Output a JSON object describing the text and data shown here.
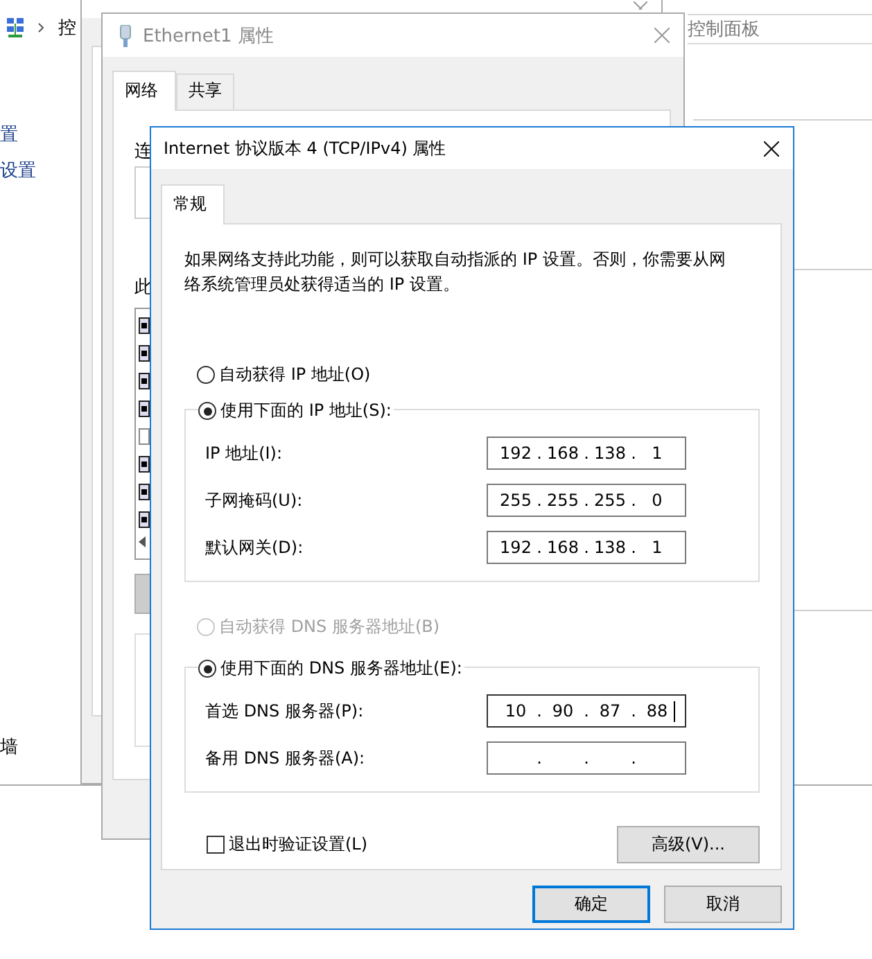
{
  "control_panel": {
    "breadcrumb": "控",
    "address_tail": "控制面板",
    "sidebar_items": [
      "置",
      "设置"
    ],
    "sidebar_bottom": "墙"
  },
  "properties_window": {
    "title": "Ethernet1 属性",
    "tabs": [
      {
        "label": "网络",
        "selected": true
      },
      {
        "label": "共享",
        "selected": false
      }
    ],
    "connect_label": "连",
    "list_label": "此",
    "components": [
      {
        "checked": true
      },
      {
        "checked": true
      },
      {
        "checked": true
      },
      {
        "checked": true
      },
      {
        "checked": false
      },
      {
        "checked": true
      },
      {
        "checked": true
      },
      {
        "checked": true
      }
    ]
  },
  "ipv4_dialog": {
    "title": "Internet 协议版本 4 (TCP/IPv4) 属性",
    "tabs": [
      {
        "label": "常规",
        "selected": true
      }
    ],
    "description": "如果网络支持此功能，则可以获取自动指派的 IP 设置。否则，你需要从网络系统管理员处获得适当的 IP 设置。",
    "separator": ".",
    "ip_options": [
      {
        "label": "自动获得 IP 地址(O)",
        "selected": false,
        "disabled": false
      },
      {
        "label": "使用下面的 IP 地址(S):",
        "selected": true,
        "disabled": false
      }
    ],
    "ip_fields": [
      {
        "label": "IP 地址(I):",
        "octets": [
          "192",
          "168",
          "138",
          "1"
        ]
      },
      {
        "label": "子网掩码(U):",
        "octets": [
          "255",
          "255",
          "255",
          "0"
        ]
      },
      {
        "label": "默认网关(D):",
        "octets": [
          "192",
          "168",
          "138",
          "1"
        ]
      }
    ],
    "dns_options": [
      {
        "label": "自动获得 DNS 服务器地址(B)",
        "selected": false,
        "disabled": true
      },
      {
        "label": "使用下面的 DNS 服务器地址(E):",
        "selected": true,
        "disabled": false
      }
    ],
    "dns_fields": [
      {
        "label": "首选 DNS 服务器(P):",
        "octets": [
          "10",
          "90",
          "87",
          "88"
        ],
        "focused": true
      },
      {
        "label": "备用 DNS 服务器(A):",
        "focused": false
      }
    ],
    "validate_checkbox": {
      "label": "退出时验证设置(L)",
      "checked": false
    },
    "advanced_button": "高级(V)...",
    "buttons": [
      {
        "label": "确定",
        "default": true
      },
      {
        "label": "取消",
        "default": false
      }
    ]
  }
}
